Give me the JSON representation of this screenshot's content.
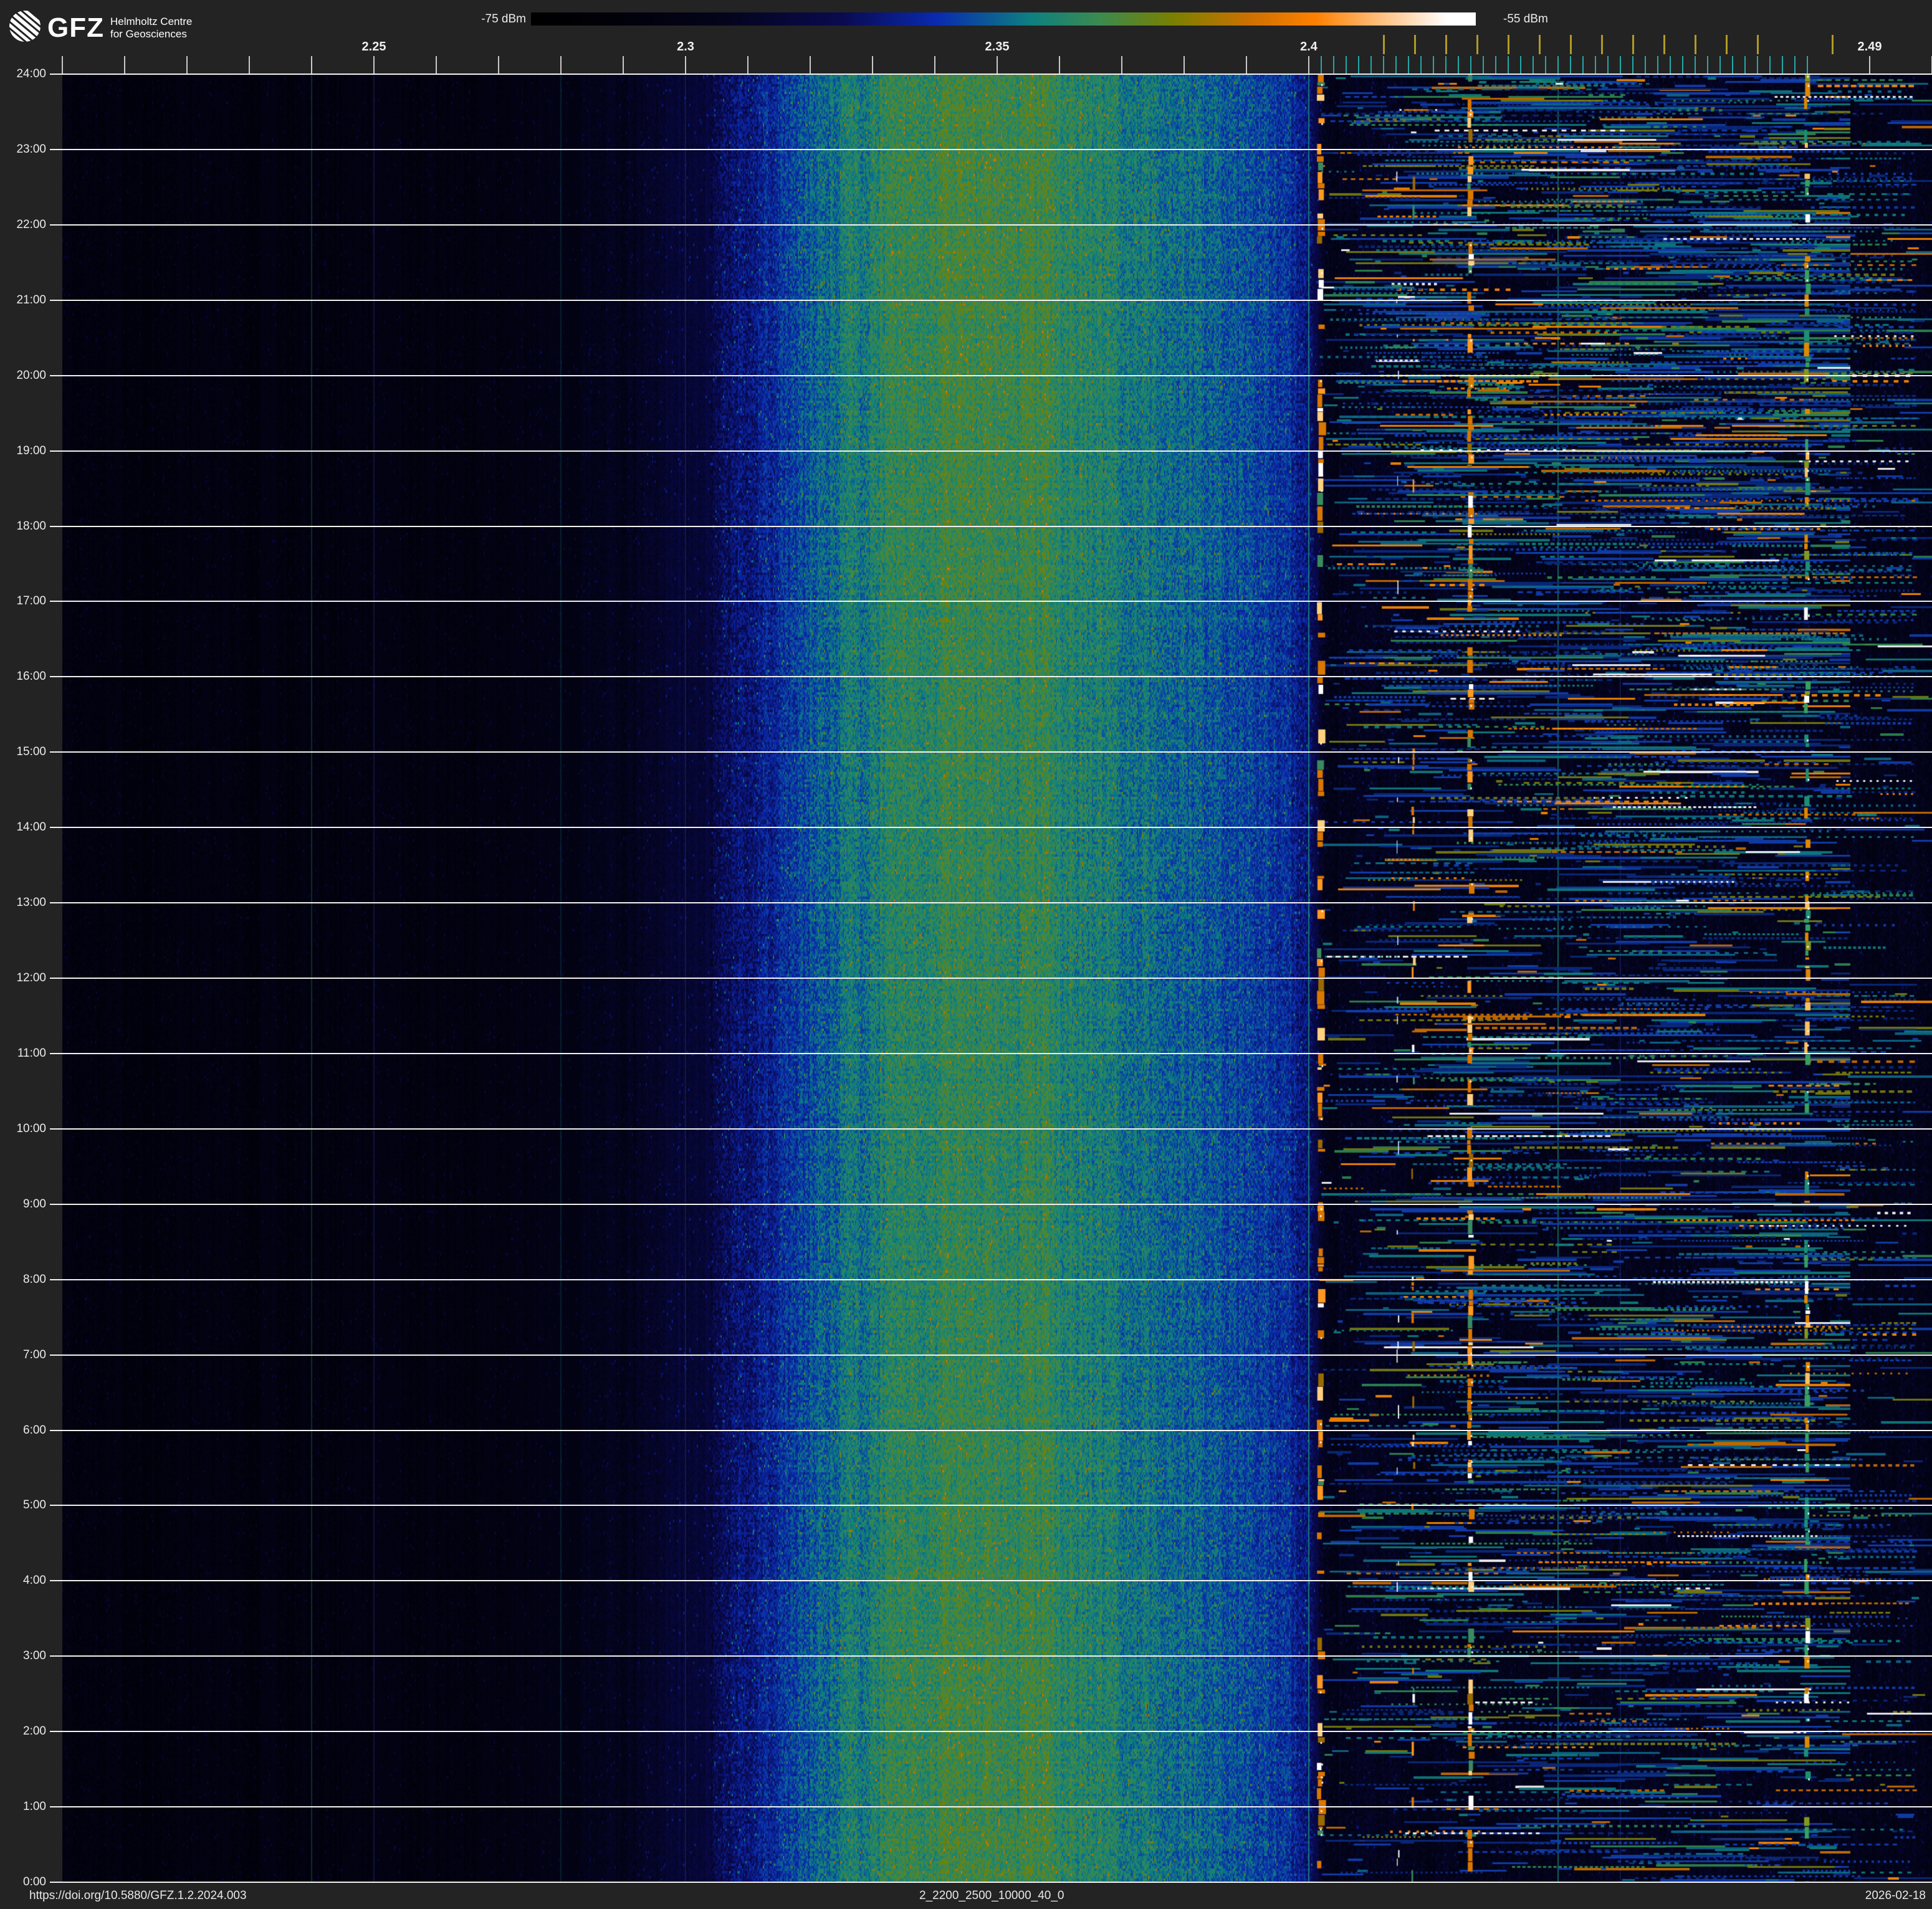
{
  "header": {
    "brand": "GFZ",
    "line1": "Helmholtz Centre",
    "line2": "for Geosciences"
  },
  "colorbar": {
    "min_label": "-75 dBm",
    "max_label": "-55 dBm",
    "stops": [
      [
        0,
        "#000000"
      ],
      [
        0.08,
        "#010108"
      ],
      [
        0.2,
        "#04041a"
      ],
      [
        0.33,
        "#0a0a50"
      ],
      [
        0.43,
        "#0a2ab0"
      ],
      [
        0.53,
        "#0e8080"
      ],
      [
        0.6,
        "#3a8a50"
      ],
      [
        0.68,
        "#7a8000"
      ],
      [
        0.76,
        "#cc7000"
      ],
      [
        0.83,
        "#ff8000"
      ],
      [
        0.9,
        "#ffc080"
      ],
      [
        0.97,
        "#ffffff"
      ],
      [
        1,
        "#ffffff"
      ]
    ]
  },
  "footer": {
    "doi": "https://doi.org/10.5880/GFZ.1.2.2024.003",
    "station": "2_2200_2500_10000_40_0",
    "date": "2026-02-18"
  },
  "chart_data": {
    "type": "heatmap",
    "title": "24h radio spectrogram 2.2-2.5 GHz",
    "power_range_dbm": [
      -75,
      -55
    ],
    "x_axis": {
      "unit": "GHz",
      "range": [
        2.2,
        2.5
      ],
      "minor_step": 0.01,
      "major_ticks": [
        {
          "v": 2.25,
          "label": "2.25"
        },
        {
          "v": 2.3,
          "label": "2.3"
        },
        {
          "v": 2.35,
          "label": "2.35"
        },
        {
          "v": 2.4,
          "label": "2.4"
        },
        {
          "v": 2.49,
          "label": "2.49"
        }
      ]
    },
    "y_axis": {
      "hour_labels": [
        "24:00",
        "23:00",
        "22:00",
        "21:00",
        "20:00",
        "19:00",
        "18:00",
        "17:00",
        "16:00",
        "15:00",
        "14:00",
        "13:00",
        "12:00",
        "11:00",
        "10:00",
        "9:00",
        "8:00",
        "7:00",
        "6:00",
        "5:00",
        "4:00",
        "3:00",
        "2:00",
        "1:00",
        "0:00"
      ]
    },
    "wifi_channels_ghz": [
      2.412,
      2.417,
      2.422,
      2.427,
      2.432,
      2.437,
      2.442,
      2.447,
      2.452,
      2.457,
      2.462,
      2.467,
      2.472,
      2.484
    ],
    "ble_channels": {
      "start_ghz": 2.402,
      "step_ghz": 0.002,
      "count": 40
    },
    "spectral_profile": [
      [
        2.2,
        0.13
      ],
      [
        2.24,
        0.135
      ],
      [
        2.258,
        0.145
      ],
      [
        2.27,
        0.155
      ],
      [
        2.282,
        0.175
      ],
      [
        2.291,
        0.21
      ],
      [
        2.298,
        0.25
      ],
      [
        2.304,
        0.3
      ],
      [
        2.31,
        0.36
      ],
      [
        2.316,
        0.43
      ],
      [
        2.322,
        0.49
      ],
      [
        2.328,
        0.54
      ],
      [
        2.334,
        0.572
      ],
      [
        2.341,
        0.59
      ],
      [
        2.35,
        0.593
      ],
      [
        2.357,
        0.58
      ],
      [
        2.364,
        0.55
      ],
      [
        2.372,
        0.525
      ],
      [
        2.38,
        0.508
      ],
      [
        2.387,
        0.485
      ],
      [
        2.393,
        0.455
      ],
      [
        2.397,
        0.415
      ],
      [
        2.3995,
        0.355
      ],
      [
        2.4012,
        0.27
      ],
      [
        2.4028,
        0.215
      ],
      [
        2.405,
        0.2
      ],
      [
        2.41,
        0.2
      ],
      [
        2.478,
        0.2
      ],
      [
        2.487,
        0.19
      ],
      [
        2.5,
        0.195
      ]
    ],
    "spur_lines": [
      {
        "f": 2.24,
        "a": 0.3
      },
      {
        "f": 2.28,
        "a": 0.2
      },
      {
        "f": 2.32,
        "a": 0.2
      },
      {
        "f": 2.36,
        "a": 0.55
      },
      {
        "f": 2.4,
        "a": 0.75
      },
      {
        "f": 2.44,
        "a": 0.65
      }
    ],
    "grid_freqs": [
      2.25,
      2.3,
      2.35,
      2.45
    ],
    "carriers": [
      {
        "f": 2.402,
        "w": 11,
        "fill": 0.62,
        "palette": "orange"
      },
      {
        "f": 2.4143,
        "w": 2,
        "fill": 0.18,
        "palette": "white"
      },
      {
        "f": 2.4168,
        "w": 4,
        "fill": 0.3,
        "palette": "orange"
      },
      {
        "f": 2.426,
        "w": 9,
        "fill": 0.8,
        "palette": "orange"
      },
      {
        "f": 2.48,
        "w": 8,
        "fill": 0.72,
        "palette": "teal"
      }
    ],
    "palettes": {
      "orange": [
        [
          "#d97700",
          0.4
        ],
        [
          "#ff9920",
          0.2
        ],
        [
          "#ffd080",
          0.14
        ],
        [
          "#ffffff",
          0.07
        ],
        [
          "#9a6a00",
          0.08
        ],
        [
          "#3a8a60",
          0.11
        ]
      ],
      "teal": [
        [
          "#1d8f75",
          0.38
        ],
        [
          "#36a060",
          0.17
        ],
        [
          "#86981c",
          0.12
        ],
        [
          "#e08800",
          0.18
        ],
        [
          "#ffc060",
          0.08
        ],
        [
          "#ffffff",
          0.07
        ]
      ],
      "white": [
        [
          "#ffffff",
          0.6
        ],
        [
          "#bcd8ff",
          0.4
        ]
      ]
    },
    "packets": {
      "region_ghz": [
        2.4015,
        2.4855
      ],
      "tail_ghz": 2.497,
      "base_per_row": 6,
      "palette": [
        [
          "#0a2a80",
          0.28
        ],
        [
          "#123fb0",
          0.22
        ],
        [
          "#0d6a8a",
          0.14
        ],
        [
          "#0e8080",
          0.12
        ],
        [
          "#2f8a50",
          0.07
        ],
        [
          "#7a8010",
          0.06
        ],
        [
          "#cc7000",
          0.05
        ],
        [
          "#ff8c00",
          0.04
        ],
        [
          "#ffffff",
          0.02
        ]
      ]
    },
    "styles": {
      "hour_line": "#f2f2f2",
      "minor_tick": "#c9c9c9",
      "wifi_tick": "#b09a25",
      "ble_tick": "#27a7a7",
      "grid_blue": "rgba(72,92,230,0.20)",
      "spur_teal": "#1a9480"
    }
  }
}
